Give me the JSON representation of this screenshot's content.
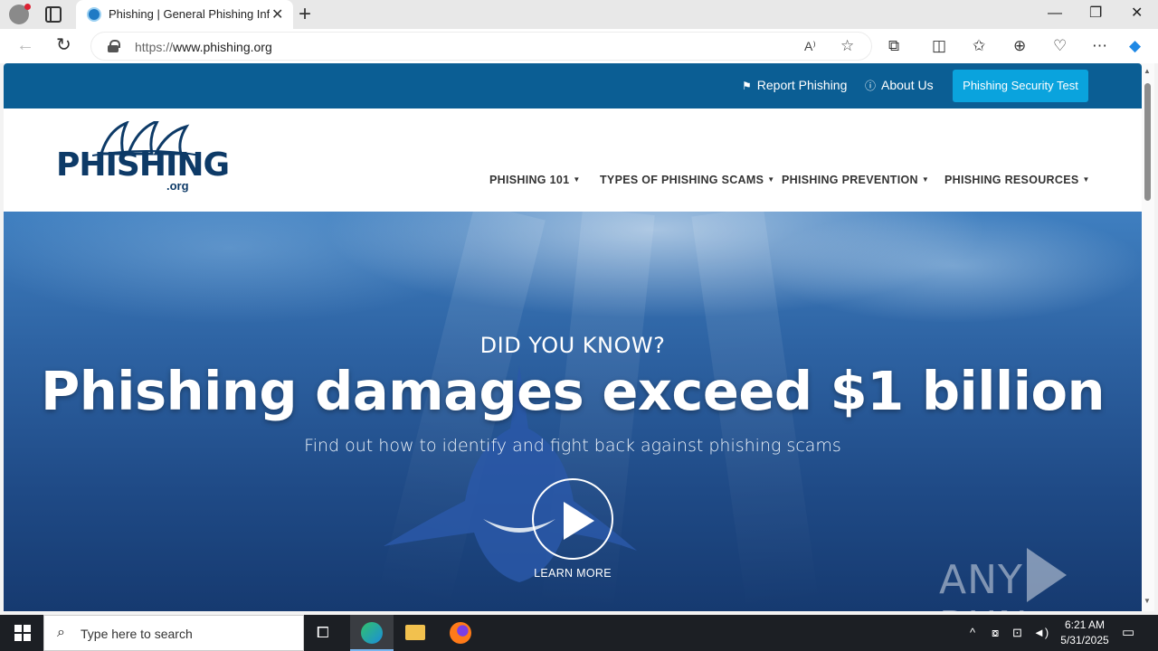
{
  "browser": {
    "tab_title": "Phishing | General Phishing Infor",
    "tab_close": "✕",
    "new_tab": "+",
    "url_scheme": "https://",
    "url_host": "www.phishing.org",
    "window_controls": {
      "minimize": "—",
      "restore": "❐",
      "close": "✕"
    }
  },
  "site": {
    "topbar": {
      "report_phishing": "Report Phishing",
      "about_us": "About Us",
      "cta": "Phishing Security Test"
    },
    "logo": {
      "word": "PHISHING",
      "tld": ".org"
    },
    "menu": [
      {
        "label": "PHISHING 101"
      },
      {
        "label": "TYPES OF PHISHING SCAMS"
      },
      {
        "label": "PHISHING PREVENTION"
      },
      {
        "label": "PHISHING RESOURCES"
      }
    ],
    "hero": {
      "kicker": "DID YOU KNOW?",
      "headline": "Phishing damages exceed $1 billion",
      "subheadline": "Find out how to identify and fight back against phishing scams",
      "learn_more": "LEARN MORE",
      "watermark_left": "ANY",
      "watermark_right": "RUN"
    }
  },
  "taskbar": {
    "search_placeholder": "Type here to search",
    "time": "6:21 AM",
    "date": "5/31/2025"
  },
  "colors": {
    "topbar_bg": "#0b5e94",
    "cta_bg": "#0aa3dd",
    "logo": "#0d3a67"
  }
}
